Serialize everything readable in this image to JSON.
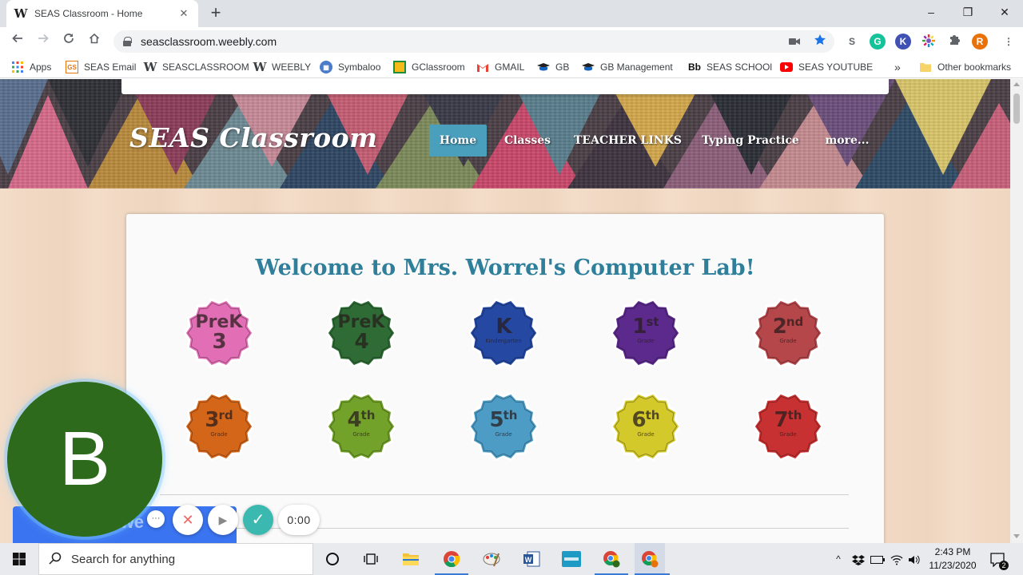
{
  "browser": {
    "tab_title": "SEAS Classroom - Home",
    "tab_favicon": "W",
    "close_glyph": "✕",
    "new_tab_glyph": "+",
    "url": "seasclassroom.weebly.com",
    "window_controls": [
      "–",
      "❐",
      "✕"
    ],
    "profile_initial": "R"
  },
  "bookmarks": {
    "items": [
      {
        "label": "Apps",
        "icon": "apps-grid-icon"
      },
      {
        "label": "SEAS Email",
        "icon": "seas-email-icon"
      },
      {
        "label": "SEASCLASSROOM",
        "icon": "weebly-icon"
      },
      {
        "label": "WEEBLY",
        "icon": "weebly-icon"
      },
      {
        "label": "Symbaloo",
        "icon": "symbaloo-icon"
      },
      {
        "label": "GClassroom",
        "icon": "google-classroom-icon"
      },
      {
        "label": "GMAIL",
        "icon": "gmail-icon"
      },
      {
        "label": "GB",
        "icon": "gradebook-icon"
      },
      {
        "label": "GB Management",
        "icon": "gradebook-icon"
      },
      {
        "label": "SEAS SCHOOl",
        "icon": "blackboard-icon"
      },
      {
        "label": "SEAS YOUTUBE",
        "icon": "youtube-icon"
      }
    ],
    "overflow": "»",
    "other": "Other bookmarks"
  },
  "site": {
    "title": "SEAS Classroom",
    "nav": [
      {
        "label": "Home",
        "active": true
      },
      {
        "label": "Classes",
        "active": false
      },
      {
        "label": "TEACHER LINKS",
        "active": false
      },
      {
        "label": "Typing Practice",
        "active": false
      },
      {
        "label": "more...",
        "active": false
      }
    ],
    "welcome": "Welcome to Mrs. Worrel's Computer Lab!",
    "grades": [
      {
        "main": "PreK",
        "line2": "3",
        "sub": "",
        "color": "#e26fb5"
      },
      {
        "main": "PreK",
        "line2": "4",
        "sub": "",
        "color": "#2e6b35"
      },
      {
        "main": "K",
        "line2": "",
        "sub": "Kindergarten",
        "color": "#2549a3"
      },
      {
        "main": "1",
        "sup": "st",
        "line2": "",
        "sub": "Grade",
        "color": "#5c2a8c"
      },
      {
        "main": "2",
        "sup": "nd",
        "line2": "",
        "sub": "Grade",
        "color": "#b5464a"
      },
      {
        "main": "3",
        "sup": "rd",
        "line2": "",
        "sub": "Grade",
        "color": "#d4661a"
      },
      {
        "main": "4",
        "sup": "th",
        "line2": "",
        "sub": "Grade",
        "color": "#72a22a"
      },
      {
        "main": "5",
        "sup": "th",
        "line2": "",
        "sub": "Grade",
        "color": "#4c9cc6"
      },
      {
        "main": "6",
        "sup": "th",
        "line2": "",
        "sub": "Grade",
        "color": "#d3c92a"
      },
      {
        "main": "7",
        "sup": "th",
        "line2": "",
        "sub": "Grade",
        "color": "#c73131"
      }
    ]
  },
  "recorder": {
    "avatar_initial": "B",
    "bar_text": "r we",
    "more_glyph": "···",
    "cancel_glyph": "✕",
    "pause_glyph": "▶",
    "done_glyph": "✓",
    "timer": "0:00"
  },
  "taskbar": {
    "search_placeholder": "Search for anything",
    "time": "2:43 PM",
    "date": "11/23/2020",
    "notification_count": "2"
  }
}
